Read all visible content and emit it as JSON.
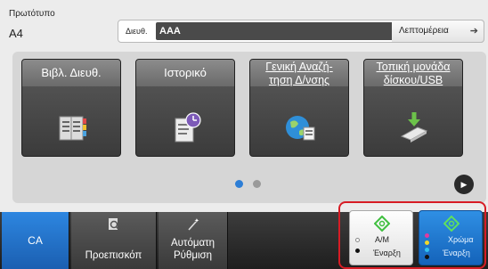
{
  "header": {
    "original_label": "Πρωτότυπο",
    "original_value": "A4",
    "address_label": "Διευθ.",
    "address_value": "AAA",
    "address_count": "1",
    "add_symbol": "+",
    "details_label": "Λεπτομέρεια",
    "details_icon": "arrow-right-icon"
  },
  "tiles": [
    {
      "label": "Βιβλ. Διευθ.",
      "icon": "address-book-icon"
    },
    {
      "label_line1": "Ιστορικό",
      "icon": "history-icon"
    },
    {
      "label_line1": "Γενική Αναζή-",
      "label_line2": "τηση Δ/νσης",
      "icon": "globe-search-icon"
    },
    {
      "label_line1": "Τοπική μονάδα",
      "label_line2": "δίσκου/USB",
      "icon": "usb-drive-icon"
    }
  ],
  "pager": {
    "pages": 2,
    "active": 1
  },
  "bottom_bar": {
    "ca_label": "CA",
    "preview_label": "Προεπισκόπ",
    "auto_label_line1": "Αυτόματη",
    "auto_label_line2": "Ρύθμιση",
    "bw_line1": "Α/Μ",
    "bw_line2": "Έναρξη",
    "color_line1": "Χρώμα",
    "color_line2": "Έναρξη"
  },
  "colors": {
    "accent_blue": "#2d86e0",
    "start_frame": "#d71c25",
    "start_icon": "#3fbf3f"
  }
}
